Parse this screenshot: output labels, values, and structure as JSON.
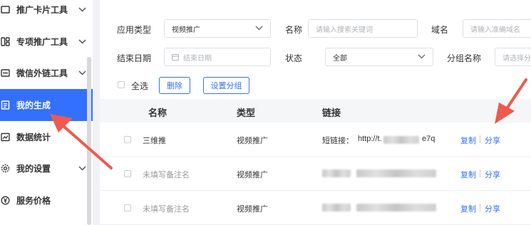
{
  "sidebar": {
    "items": [
      {
        "label": "推广卡片工具",
        "icon": "card-icon",
        "expandable": true
      },
      {
        "label": "专项推广工具",
        "icon": "grid-icon",
        "expandable": true
      },
      {
        "label": "微信外链工具",
        "icon": "link-box-icon",
        "expandable": true
      },
      {
        "label": "我的生成",
        "icon": "document-icon",
        "expandable": false,
        "active": true
      },
      {
        "label": "数据统计",
        "icon": "chart-icon",
        "expandable": false
      },
      {
        "label": "我的设置",
        "icon": "gear-icon",
        "expandable": true
      },
      {
        "label": "服务价格",
        "icon": "yen-icon",
        "expandable": false
      }
    ]
  },
  "filters": {
    "app_type_label": "应用类型",
    "app_type_value": "视频推广",
    "name_label": "名称",
    "name_placeholder": "请输入搜索关键词",
    "domain_label": "域名",
    "domain_placeholder": "请输入准确域名",
    "end_date_label": "结束日期",
    "end_date_placeholder": "结束日期",
    "status_label": "状态",
    "status_value": "全部",
    "group_label": "分组名称",
    "group_placeholder": "请选择分组"
  },
  "actions": {
    "select_all": "全选",
    "delete": "删除",
    "set_group": "设置分组"
  },
  "table": {
    "columns": [
      "名称",
      "类型",
      "链接"
    ],
    "rows": [
      {
        "name": "三维推",
        "type": "视频推广",
        "link_prefix": "短链接：",
        "link_start": "http://t.",
        "link_end": "e7q",
        "copy": "复制",
        "share": "分享"
      },
      {
        "name": "未填写备注名",
        "type": "视频推广",
        "copy": "复制",
        "share": "分享"
      },
      {
        "name": "未填写备注名",
        "type": "视频推广",
        "copy": "复制",
        "share": "分享"
      }
    ]
  },
  "colors": {
    "accent": "#3370ff",
    "annotation": "#ee5a4f"
  }
}
